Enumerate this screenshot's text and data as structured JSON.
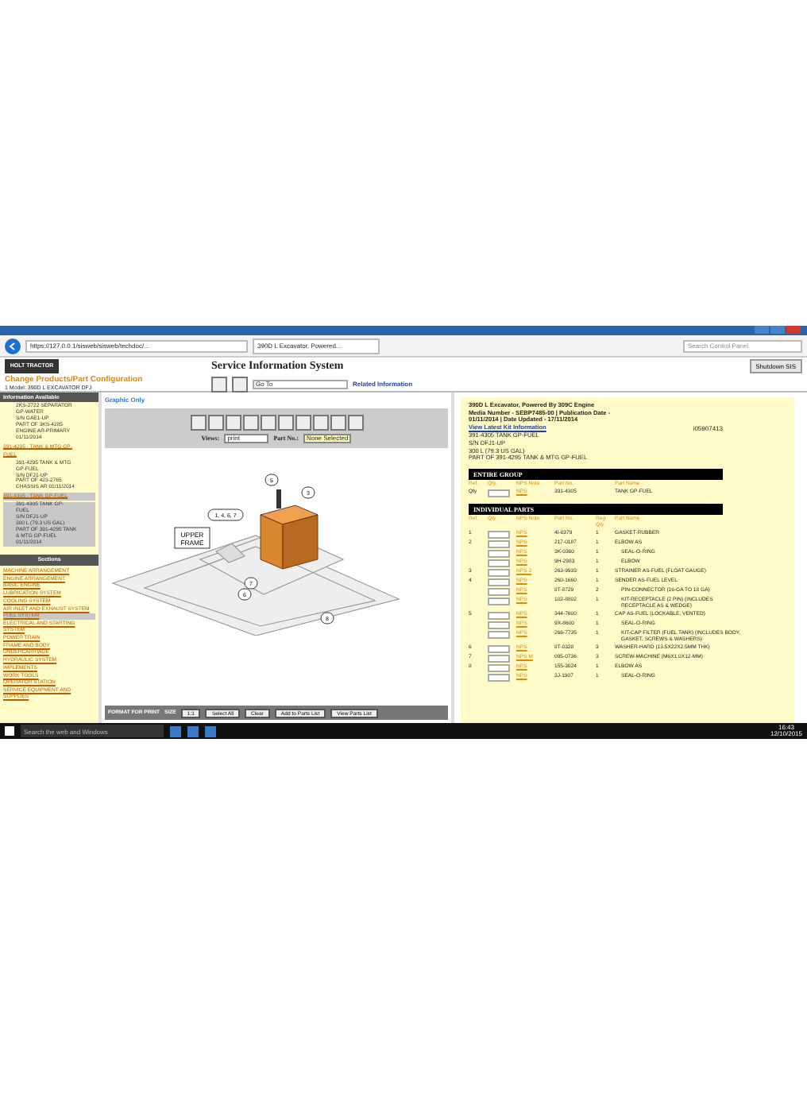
{
  "browser": {
    "address": "https://127.0.0.1/sisweb/sisweb/techdoc/...",
    "tab": "390D L Excavator, Powered...",
    "search": "Search Control Panel"
  },
  "header": {
    "logo": "HOLT TRACTOR",
    "title": "Service Information System",
    "change_link": "Change Products/Part Configuration",
    "model": "1 Model: 390D L EXCAVATOR DFJ",
    "goto": "Go To",
    "related": "Related Information",
    "shutdown": "Shutdown SIS"
  },
  "sidebar": {
    "info_title": "Information Available",
    "info_items": [
      {
        "kind": "text",
        "selected": false,
        "lines": [
          "2KS-2722 SEPARATOR",
          "GP-WATER",
          "S/N GAE1-UP",
          "PART OF 3KS-4285",
          "ENGINE AR-PRIMARY",
          "01/11/2014"
        ]
      },
      {
        "kind": "link",
        "selected": false,
        "lines": [
          "391-4295 - TANK & MTG GP-",
          "FUEL"
        ]
      },
      {
        "kind": "text",
        "selected": false,
        "lines": [
          "391-4295 TANK & MTG",
          "GP-FUEL",
          "S/N DFJ1-UP",
          "PART OF 423-2765",
          "CHASSIS AR 01/11/2014"
        ]
      },
      {
        "kind": "link",
        "selected": true,
        "lines": [
          "391-4305 - TANK GP-FUEL"
        ]
      },
      {
        "kind": "text",
        "selected": true,
        "lines": [
          "391-4305 TANK GP-",
          "FUEL",
          "S/N DFJ1-UP",
          "300 L (79.3 US GAL)",
          "PART OF 391-4295 TANK",
          "& MTG GP-FUEL",
          "01/11/2014"
        ]
      }
    ],
    "sections_title": "Sections",
    "sections": [
      {
        "label": "MACHINE ARRANGEMENT",
        "selected": false
      },
      {
        "label": "ENGINE ARRANGEMENT",
        "selected": false
      },
      {
        "label": "BASIC ENGINE",
        "selected": false
      },
      {
        "label": "LUBRICATION SYSTEM",
        "selected": false
      },
      {
        "label": "COOLING SYSTEM",
        "selected": false
      },
      {
        "label": "AIR INLET AND EXHAUST SYSTEM",
        "selected": false
      },
      {
        "label": "FUEL SYSTEM",
        "selected": true
      },
      {
        "label": "ELECTRICAL AND STARTING SYSTEM",
        "selected": false
      },
      {
        "label": "POWER TRAIN",
        "selected": false
      },
      {
        "label": "FRAME AND BODY",
        "selected": false
      },
      {
        "label": "UNDERCARRIAGE",
        "selected": false
      },
      {
        "label": "HYDRAULIC SYSTEM",
        "selected": false
      },
      {
        "label": "IMPLEMENTS",
        "selected": false
      },
      {
        "label": "WORK TOOLS",
        "selected": false
      },
      {
        "label": "OPERATOR STATION",
        "selected": false
      },
      {
        "label": "SERVICE EQUIPMENT AND SUPPLIES",
        "selected": false
      }
    ]
  },
  "graphic": {
    "title": "Graphic Only",
    "views_label": "Views:",
    "views_value": "print",
    "partno_label": "Part No.:",
    "partno_value": "None Selected",
    "callouts": [
      "5",
      "3",
      "1, 4, 6, 7",
      "7",
      "6",
      "8"
    ],
    "frame_label": [
      "UPPER",
      "FRAME"
    ],
    "footer": {
      "format": "FORMAT FOR PRINT",
      "size_label": "SIZE",
      "size_value": "1:1",
      "buttons": [
        "Select All",
        "Clear",
        "Add to Parts List",
        "View Parts List"
      ]
    }
  },
  "parts": {
    "intro": [
      "390D L Excavator, Powered By 309C Engine",
      "Media Number - SEBP7485-00  |  Publication Date -",
      "01/11/2014  |  Date Updated - 17/11/2014"
    ],
    "kit_link": "View Latest Kit Information",
    "code": "i05907413",
    "details": [
      "391-4305 TANK GP-FUEL",
      "S/N DFJ1-UP",
      "300 L (79.3 US GAL)",
      "PART OF 391-4295 TANK & MTG GP-FUEL"
    ],
    "entire_title": "ENTIRE GROUP",
    "entire_columns": [
      "Ref.",
      "Qty.",
      "NPS Note",
      "Part No.",
      "Part Name"
    ],
    "entire_row": {
      "ref": "Qty",
      "nps": "NPS",
      "part_no": "391-4305",
      "name": "TANK GP-FUEL"
    },
    "individual_title": "INDIVIDUAL PARTS",
    "individual_columns": [
      "Ref.",
      "Qty.",
      "NPS Note",
      "Part No.",
      "Reg Qty.",
      "Part Name"
    ],
    "rows": [
      {
        "ref": "1",
        "nps": "NPS",
        "part_no": "4I-0379",
        "qty": "1",
        "name": "GASKET-RUBBER"
      },
      {
        "ref": "2",
        "nps": "NPS",
        "part_no": "217-0187",
        "qty": "1",
        "name": "ELBOW AS",
        "children": [
          {
            "nps": "NPS",
            "part_no": "3K-0360",
            "qty": "1",
            "name": "SEAL-O-RING"
          },
          {
            "nps": "NPS",
            "part_no": "9H-2983",
            "qty": "1",
            "name": "ELBOW"
          }
        ]
      },
      {
        "ref": "3",
        "nps": "NPS 2",
        "part_no": "263-9933",
        "qty": "1",
        "name": "STRAINER AS-FUEL (FLOAT GAUGE)"
      },
      {
        "ref": "4",
        "nps": "NPS",
        "part_no": "260-1660",
        "qty": "1",
        "name": "SENDER AS-FUEL LEVEL",
        "children": [
          {
            "nps": "NPS",
            "part_no": "8T-8729",
            "qty": "2",
            "name": "PIN-CONNECTOR (16-GA TO 18 GA)"
          },
          {
            "nps": "NPS",
            "part_no": "102-8802",
            "qty": "1",
            "name": "KIT-RECEPTACLE (2 PIN) (INCLUDES RECEPTACLE AS & WEDGE)"
          }
        ]
      },
      {
        "ref": "5",
        "nps": "NPS",
        "part_no": "344-7600",
        "qty": "1",
        "name": "CAP AS-FUEL (LOCKABLE, VENTED)",
        "children": [
          {
            "nps": "NPS",
            "part_no": "9X-8600",
            "qty": "1",
            "name": "SEAL-O-RING"
          },
          {
            "nps": "NPS",
            "part_no": "266-7735",
            "qty": "1",
            "name": "KIT-CAP FILTER (FUEL TANK) (INCLUDES BODY, GASKET, SCREWS & WASHERS)"
          }
        ]
      },
      {
        "ref": "6",
        "nps": "NPS",
        "part_no": "8T-0328",
        "qty": "3",
        "name": "WASHER-HARD (13.5X22X2.5MM THK)"
      },
      {
        "ref": "7",
        "nps": "NPS M",
        "part_no": "095-0736",
        "qty": "3",
        "name": "SCREW-MACHINE (M6X1.0X12-MM)"
      },
      {
        "ref": "8",
        "nps": "NPS",
        "part_no": "155-3024",
        "qty": "1",
        "name": "ELBOW AS",
        "children": [
          {
            "nps": "NPS",
            "part_no": "3J-1907",
            "qty": "1",
            "name": "SEAL-O-RING"
          }
        ]
      }
    ]
  },
  "taskbar": {
    "search": "Search the web and Windows",
    "time": "16:43",
    "date": "12/10/2015"
  }
}
